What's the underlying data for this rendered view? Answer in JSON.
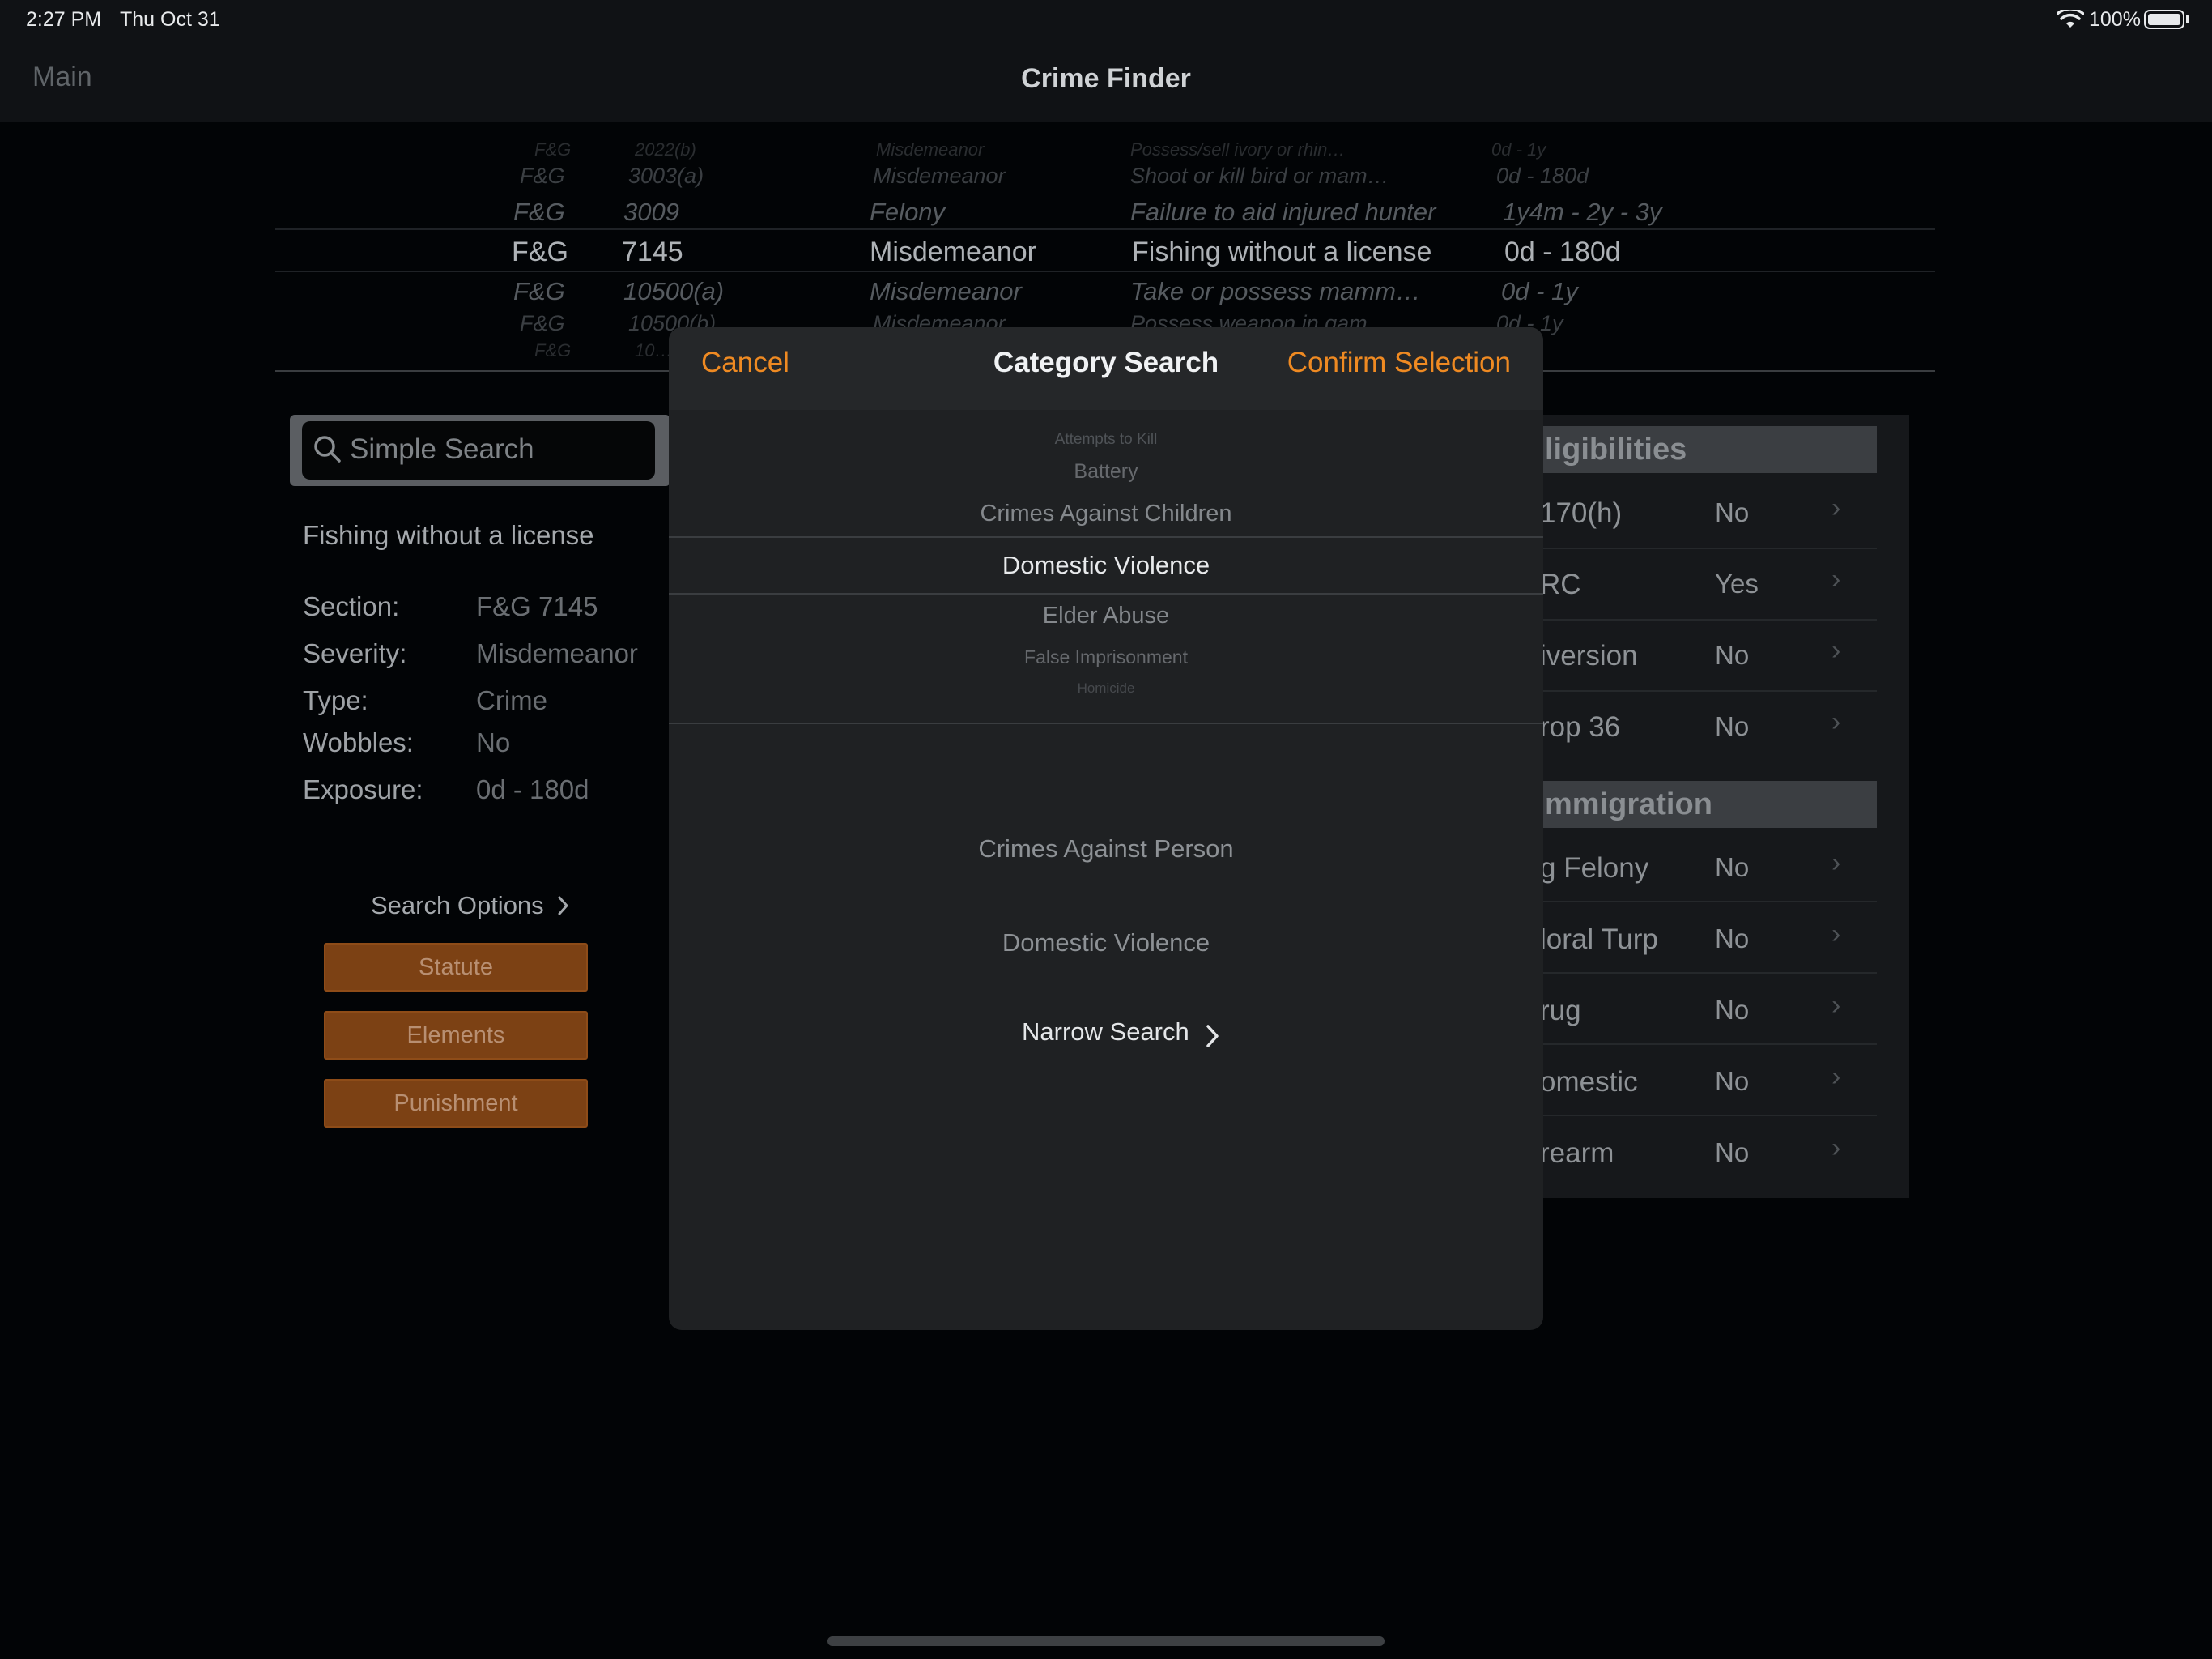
{
  "status_bar": {
    "time": "2:27 PM",
    "date": "Thu Oct 31",
    "battery": "100%"
  },
  "nav": {
    "back_label": "Main",
    "title": "Crime Finder"
  },
  "statute_picker": {
    "rows": [
      {
        "code": "F&G",
        "section": "2022(b)",
        "severity": "Misdemeanor",
        "description": "Possess/sell ivory or rhin…",
        "exposure": "0d - 1y"
      },
      {
        "code": "F&G",
        "section": "3003(a)",
        "severity": "Misdemeanor",
        "description": "Shoot or kill bird or mam…",
        "exposure": "0d - 180d"
      },
      {
        "code": "F&G",
        "section": "3009",
        "severity": "Felony",
        "description": "Failure to aid injured hunter",
        "exposure": "1y4m - 2y - 3y"
      },
      {
        "code": "F&G",
        "section": "7145",
        "severity": "Misdemeanor",
        "description": "Fishing without a license",
        "exposure": "0d - 180d"
      },
      {
        "code": "F&G",
        "section": "10500(a)",
        "severity": "Misdemeanor",
        "description": "Take or possess mamm…",
        "exposure": "0d - 1y"
      },
      {
        "code": "F&G",
        "section": "10500(b)",
        "severity": "Misdemeanor",
        "description": "Possess weapon in gam…",
        "exposure": "0d - 1y"
      },
      {
        "code": "F&G",
        "section": "10…",
        "severity": "",
        "description": "",
        "exposure": ""
      }
    ]
  },
  "search": {
    "placeholder": "Simple Search",
    "value": ""
  },
  "details": {
    "crime_name": "Fishing without a license",
    "section_label": "Section:",
    "section_value": "F&G 7145",
    "severity_label": "Severity:",
    "severity_value": "Misdemeanor",
    "type_label": "Type:",
    "type_value": "Crime",
    "wobbles_label": "Wobbles:",
    "wobbles_value": "No",
    "exposure_label": "Exposure:",
    "exposure_value": "0d - 180d"
  },
  "search_options": {
    "label": "Search Options",
    "buttons": [
      "Statute",
      "Elements",
      "Punishment"
    ]
  },
  "eligibilities": {
    "header": "ligibilities",
    "items": [
      {
        "label": "170(h)",
        "value": "No"
      },
      {
        "label": "RC",
        "value": "Yes"
      },
      {
        "label": "iversion",
        "value": "No"
      },
      {
        "label": "rop 36",
        "value": "No"
      }
    ]
  },
  "immigration": {
    "header": "mmigration",
    "items": [
      {
        "label": "g Felony",
        "value": "No"
      },
      {
        "label": "loral Turp",
        "value": "No"
      },
      {
        "label": "rug",
        "value": "No"
      },
      {
        "label": "omestic",
        "value": "No"
      },
      {
        "label": "rearm",
        "value": "No"
      }
    ]
  },
  "modal": {
    "cancel_label": "Cancel",
    "title": "Category Search",
    "confirm_label": "Confirm Selection",
    "categories": [
      "Attempts to Kill",
      "Battery",
      "Crimes Against Children",
      "Domestic Violence",
      "Elder Abuse",
      "False Imprisonment",
      "Homicide"
    ],
    "selected_category": "Domestic Violence",
    "summary_category": "Crimes Against Person",
    "summary_subcategory": "Domestic Violence",
    "narrow_search_label": "Narrow Search"
  },
  "colors": {
    "accent": "#ef8a22",
    "button_fill": "#7c4114",
    "background": "#020406",
    "modal": "#1f2123"
  }
}
